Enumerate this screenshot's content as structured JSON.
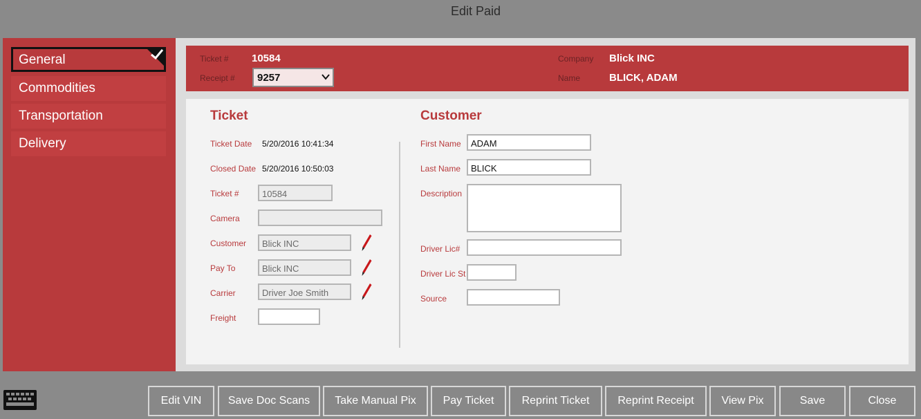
{
  "window": {
    "title": "Edit Paid"
  },
  "sidebar": {
    "items": [
      {
        "label": "General",
        "active": true
      },
      {
        "label": "Commodities"
      },
      {
        "label": "Transportation"
      },
      {
        "label": "Delivery"
      }
    ]
  },
  "header": {
    "ticket_label": "Ticket #",
    "ticket_value": "10584",
    "receipt_label": "Receipt #",
    "receipt_value": "9257",
    "company_label": "Company",
    "company_value": "Blick INC",
    "name_label": "Name",
    "name_value": "BLICK, ADAM"
  },
  "ticket": {
    "title": "Ticket",
    "ticket_date_label": "Ticket Date",
    "ticket_date": "5/20/2016 10:41:34",
    "closed_date_label": "Closed Date",
    "closed_date": "5/20/2016 10:50:03",
    "ticket_no_label": "Ticket #",
    "ticket_no": "10584",
    "camera_label": "Camera",
    "camera": "",
    "customer_label": "Customer",
    "customer": "Blick INC",
    "pay_to_label": "Pay To",
    "pay_to": "Blick INC",
    "carrier_label": "Carrier",
    "carrier": "Driver Joe Smith",
    "freight_label": "Freight",
    "freight": ""
  },
  "customer": {
    "title": "Customer",
    "first_name_label": "First Name",
    "first_name": "ADAM",
    "last_name_label": "Last Name",
    "last_name": "BLICK",
    "description_label": "Description",
    "description": "",
    "driver_lic_label": "Driver Lic#",
    "driver_lic": "",
    "driver_lic_st_label": "Driver Lic St",
    "driver_lic_st": "",
    "source_label": "Source",
    "source": ""
  },
  "buttons": {
    "edit_vin": "Edit VIN",
    "save_doc_scans": "Save Doc Scans",
    "take_manual_pix": "Take Manual Pix",
    "pay_ticket": "Pay Ticket",
    "reprint_ticket": "Reprint Ticket",
    "reprint_receipt": "Reprint Receipt",
    "view_pix": "View Pix",
    "save": "Save",
    "close": "Close"
  },
  "icons": {
    "keyboard": "keyboard-icon",
    "pencil": "pencil-icon",
    "check": "check-icon",
    "dropdown": "chevron-down-icon"
  },
  "colors": {
    "accent": "#b83a3c",
    "background": "#8a8a8a",
    "panel": "#f3f3f3"
  }
}
